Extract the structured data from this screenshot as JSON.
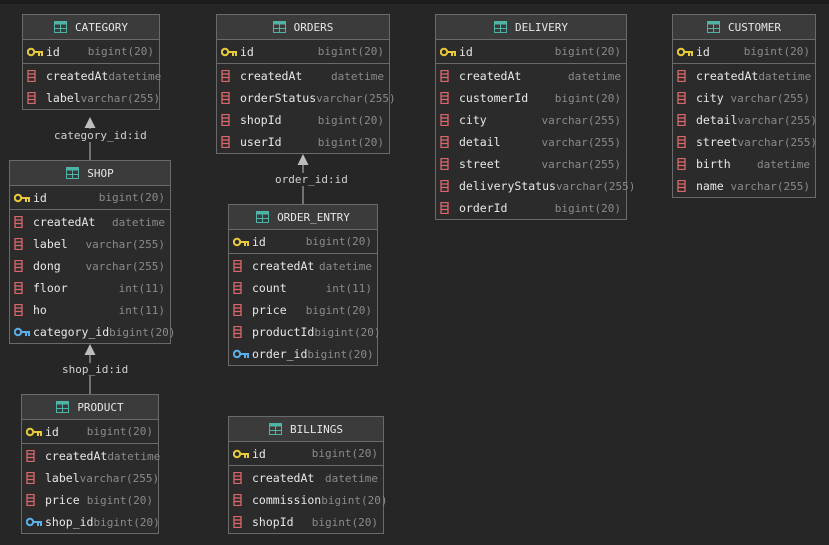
{
  "links": [
    {
      "label": "category_id:id",
      "from": "shop",
      "to": "category"
    },
    {
      "label": "shop_id:id",
      "from": "product",
      "to": "shop"
    },
    {
      "label": "order_id:id",
      "from": "order_entry",
      "to": "orders"
    }
  ],
  "entities": [
    {
      "key": "category",
      "title": "CATEGORY",
      "pk": {
        "name": "id",
        "type": "bigint(20)",
        "kind": "pk"
      },
      "columns": [
        {
          "name": "createdAt",
          "type": "datetime",
          "kind": "col"
        },
        {
          "name": "label",
          "type": "varchar(255)",
          "kind": "col"
        }
      ]
    },
    {
      "key": "orders",
      "title": "ORDERS",
      "pk": {
        "name": "id",
        "type": "bigint(20)",
        "kind": "pk"
      },
      "columns": [
        {
          "name": "createdAt",
          "type": "datetime",
          "kind": "col"
        },
        {
          "name": "orderStatus",
          "type": "varchar(255)",
          "kind": "col"
        },
        {
          "name": "shopId",
          "type": "bigint(20)",
          "kind": "col"
        },
        {
          "name": "userId",
          "type": "bigint(20)",
          "kind": "col"
        }
      ]
    },
    {
      "key": "delivery",
      "title": "DELIVERY",
      "pk": {
        "name": "id",
        "type": "bigint(20)",
        "kind": "pk"
      },
      "columns": [
        {
          "name": "createdAt",
          "type": "datetime",
          "kind": "col"
        },
        {
          "name": "customerId",
          "type": "bigint(20)",
          "kind": "col"
        },
        {
          "name": "city",
          "type": "varchar(255)",
          "kind": "col"
        },
        {
          "name": "detail",
          "type": "varchar(255)",
          "kind": "col"
        },
        {
          "name": "street",
          "type": "varchar(255)",
          "kind": "col"
        },
        {
          "name": "deliveryStatus",
          "type": "varchar(255)",
          "kind": "col"
        },
        {
          "name": "orderId",
          "type": "bigint(20)",
          "kind": "col"
        }
      ]
    },
    {
      "key": "customer",
      "title": "CUSTOMER",
      "pk": {
        "name": "id",
        "type": "bigint(20)",
        "kind": "pk"
      },
      "columns": [
        {
          "name": "createdAt",
          "type": "datetime",
          "kind": "col"
        },
        {
          "name": "city",
          "type": "varchar(255)",
          "kind": "col"
        },
        {
          "name": "detail",
          "type": "varchar(255)",
          "kind": "col"
        },
        {
          "name": "street",
          "type": "varchar(255)",
          "kind": "col"
        },
        {
          "name": "birth",
          "type": "datetime",
          "kind": "col"
        },
        {
          "name": "name",
          "type": "varchar(255)",
          "kind": "col"
        }
      ]
    },
    {
      "key": "shop",
      "title": "SHOP",
      "pk": {
        "name": "id",
        "type": "bigint(20)",
        "kind": "pk"
      },
      "columns": [
        {
          "name": "createdAt",
          "type": "datetime",
          "kind": "col"
        },
        {
          "name": "label",
          "type": "varchar(255)",
          "kind": "col"
        },
        {
          "name": "dong",
          "type": "varchar(255)",
          "kind": "col"
        },
        {
          "name": "floor",
          "type": "int(11)",
          "kind": "col"
        },
        {
          "name": "ho",
          "type": "int(11)",
          "kind": "col"
        },
        {
          "name": "category_id",
          "type": "bigint(20)",
          "kind": "fk"
        }
      ]
    },
    {
      "key": "order_entry",
      "title": "ORDER_ENTRY",
      "pk": {
        "name": "id",
        "type": "bigint(20)",
        "kind": "pk"
      },
      "columns": [
        {
          "name": "createdAt",
          "type": "datetime",
          "kind": "col"
        },
        {
          "name": "count",
          "type": "int(11)",
          "kind": "col"
        },
        {
          "name": "price",
          "type": "bigint(20)",
          "kind": "col"
        },
        {
          "name": "productId",
          "type": "bigint(20)",
          "kind": "col"
        },
        {
          "name": "order_id",
          "type": "bigint(20)",
          "kind": "fk"
        }
      ]
    },
    {
      "key": "product",
      "title": "PRODUCT",
      "pk": {
        "name": "id",
        "type": "bigint(20)",
        "kind": "pk"
      },
      "columns": [
        {
          "name": "createdAt",
          "type": "datetime",
          "kind": "col"
        },
        {
          "name": "label",
          "type": "varchar(255)",
          "kind": "col"
        },
        {
          "name": "price",
          "type": "bigint(20)",
          "kind": "col"
        },
        {
          "name": "shop_id",
          "type": "bigint(20)",
          "kind": "fk"
        }
      ]
    },
    {
      "key": "billings",
      "title": "BILLINGS",
      "pk": {
        "name": "id",
        "type": "bigint(20)",
        "kind": "pk"
      },
      "columns": [
        {
          "name": "createdAt",
          "type": "datetime",
          "kind": "col"
        },
        {
          "name": "commission",
          "type": "bigint(20)",
          "kind": "col"
        },
        {
          "name": "shopId",
          "type": "bigint(20)",
          "kind": "col"
        }
      ]
    }
  ],
  "colors": {
    "table_icon": "#4fb3a5",
    "key_icon": "#e8c93a",
    "fk_icon": "#5ab0e8",
    "column_icon": "#d9686a",
    "connector": "#bdbdbd"
  }
}
